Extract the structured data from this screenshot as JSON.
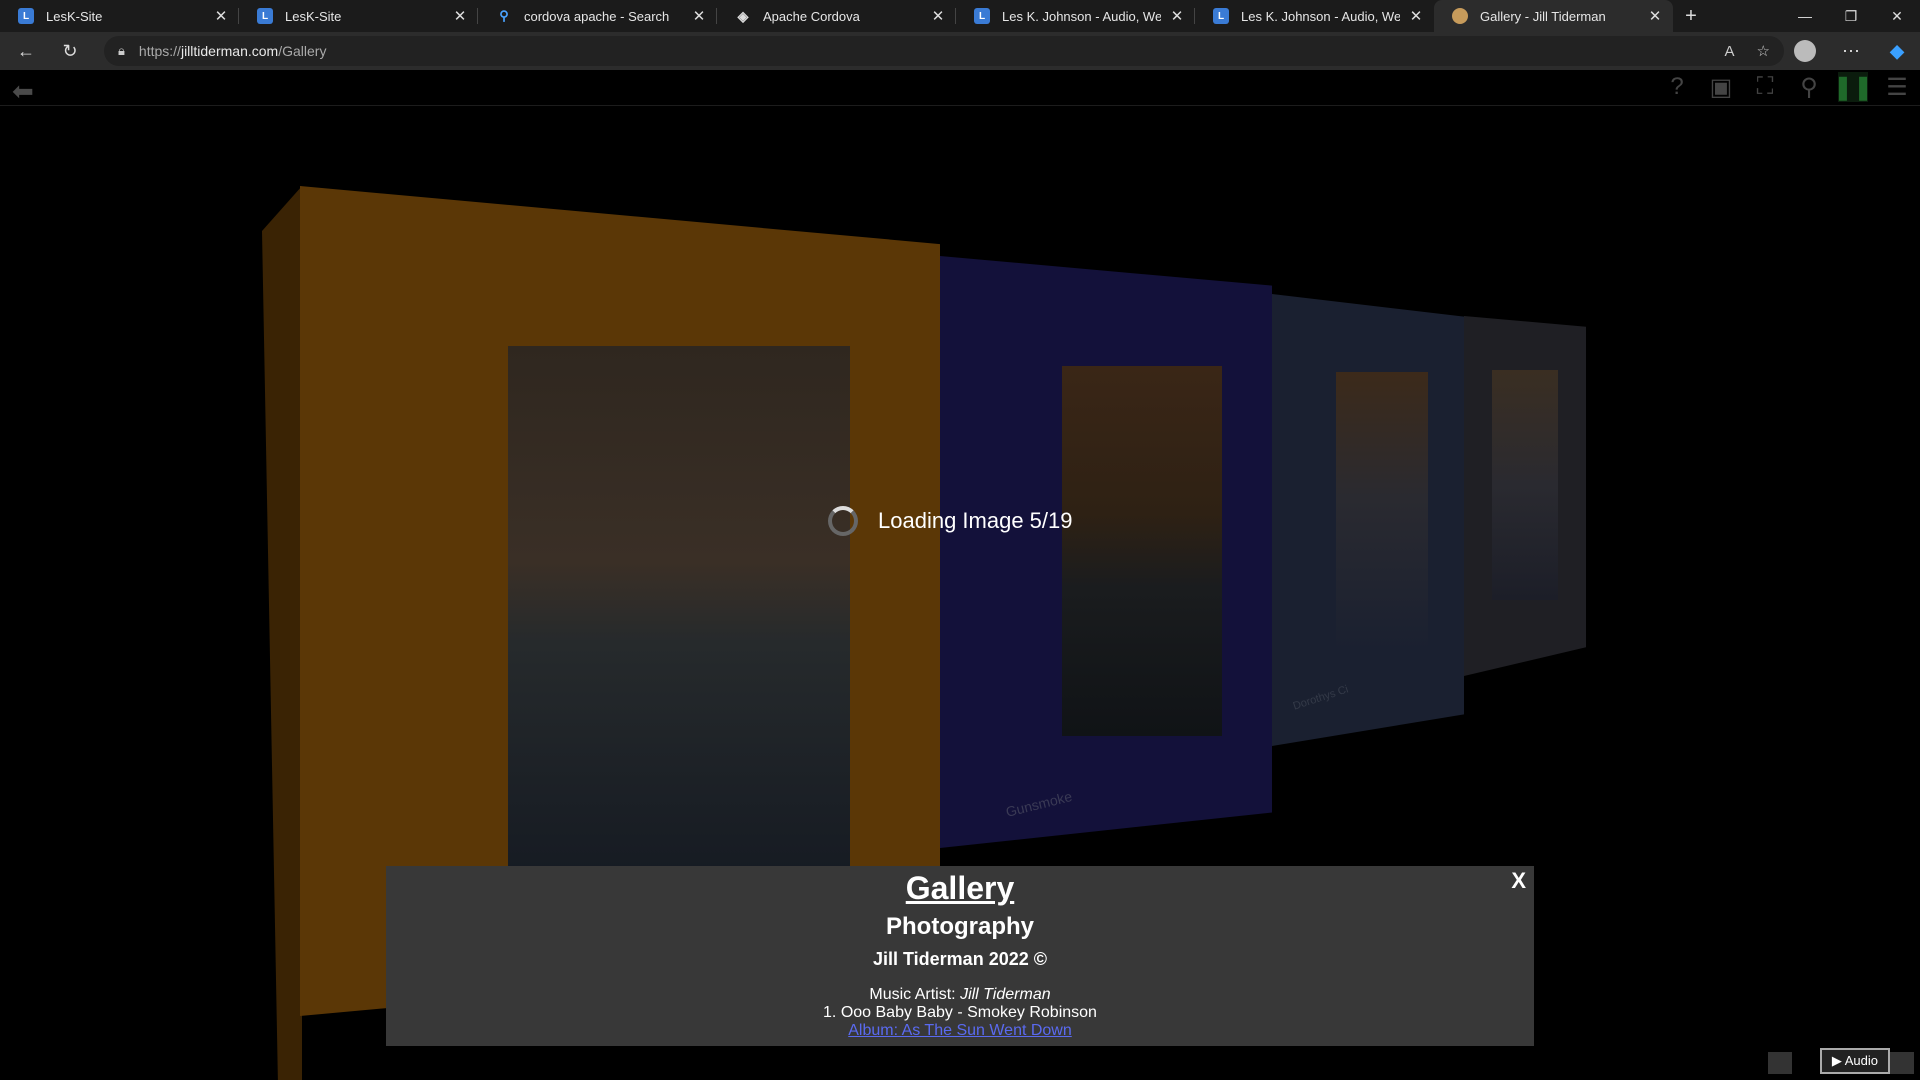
{
  "browser": {
    "tabs": [
      {
        "title": "LesK-Site",
        "icon": "site-icon",
        "active": false
      },
      {
        "title": "LesK-Site",
        "icon": "site-icon",
        "active": false
      },
      {
        "title": "cordova apache - Search",
        "icon": "search-icon",
        "active": false
      },
      {
        "title": "Apache Cordova",
        "icon": "cordova-icon",
        "active": false
      },
      {
        "title": "Les K. Johnson - Audio, Web and",
        "icon": "site-icon",
        "active": false
      },
      {
        "title": "Les K. Johnson - Audio, Web and",
        "icon": "site-icon",
        "active": false
      },
      {
        "title": "Gallery - Jill Tiderman",
        "icon": "jill-icon",
        "active": true
      }
    ],
    "url_scheme": "https://",
    "url_host": "jilltiderman.com",
    "url_path": "/Gallery"
  },
  "gallery": {
    "panel2_caption": "Gunsmoke",
    "panel3_caption": "Dorothys Ci",
    "loading_text": "Loading Image 5/19"
  },
  "info": {
    "close": "X",
    "title": "Gallery",
    "subtitle": "Photography",
    "copyright": "Jill Tiderman 2022 ©",
    "music_label": "Music Artist:",
    "music_artist": "Jill Tiderman",
    "track": "1. Ooo Baby Baby - Smokey Robinson",
    "album_link": "Album: As The Sun Went Down"
  },
  "audio": {
    "label": "▶ Audio"
  },
  "colors": {
    "accent_link": "#5a6af0",
    "panel_orange": "#5b3706",
    "panel_navy": "#13113a"
  }
}
